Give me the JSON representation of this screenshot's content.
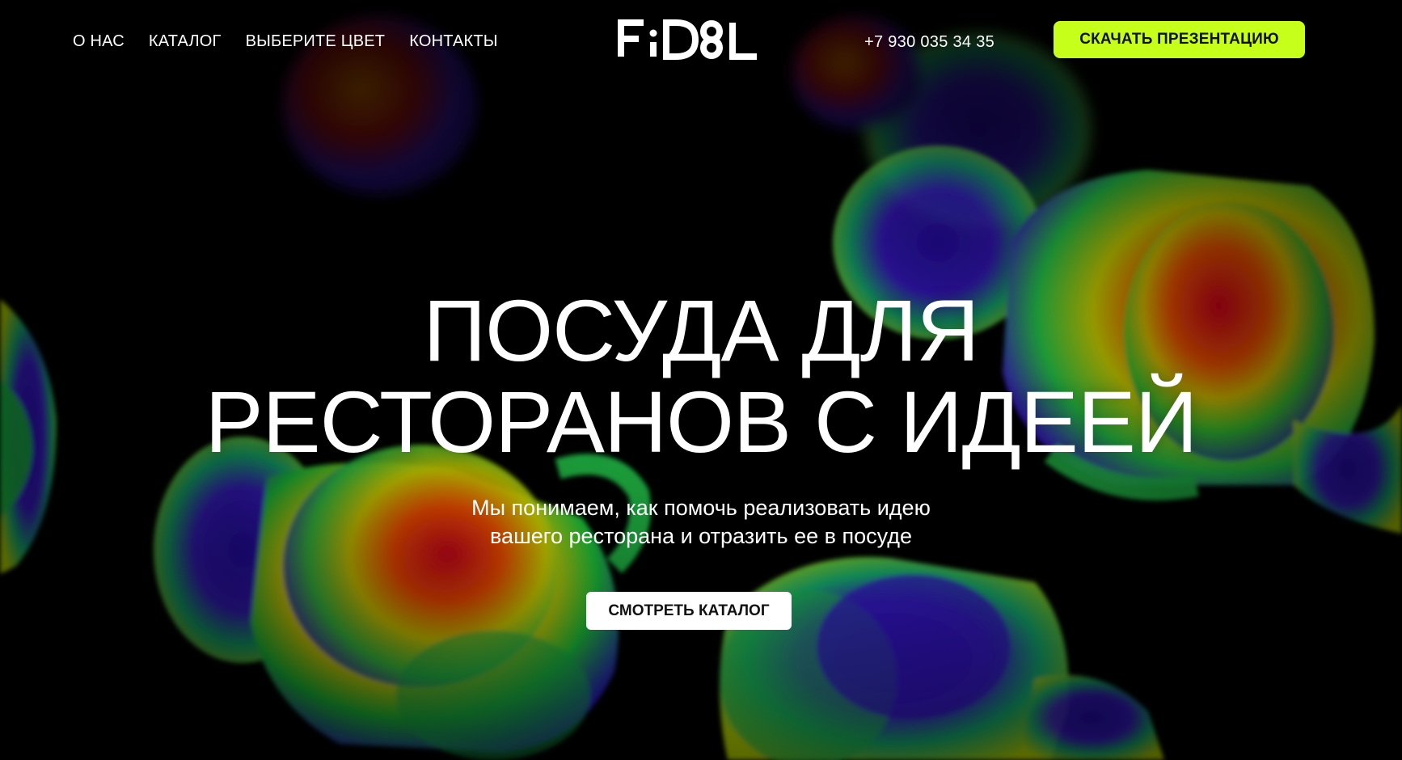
{
  "header": {
    "nav": [
      {
        "label": "О НАС"
      },
      {
        "label": "КАТАЛОГ"
      },
      {
        "label": "ВЫБЕРИТЕ ЦВЕТ"
      },
      {
        "label": "КОНТАКТЫ"
      }
    ],
    "logo_text": "FiDEL",
    "phone": "+7 930 035 34 35",
    "cta_label": "СКАЧАТЬ ПРЕЗЕНТАЦИЮ"
  },
  "hero": {
    "headline_line1": "ПОСУДА ДЛЯ",
    "headline_line2": "РЕСТОРАНОВ С ИДЕЕЙ",
    "subtitle_line1": "Мы понимаем, как помочь реализовать идею",
    "subtitle_line2": "вашего ресторана и отразить ее в посуде",
    "catalog_button": "СМОТРЕТЬ КАТАЛОГ"
  },
  "colors": {
    "background": "#000000",
    "cta_accent": "#c6ff1a",
    "text": "#ffffff",
    "button_bg": "#ffffff"
  },
  "icons": {
    "logo": "fidel-logo",
    "background": "iridescent-mugs-illustration"
  }
}
